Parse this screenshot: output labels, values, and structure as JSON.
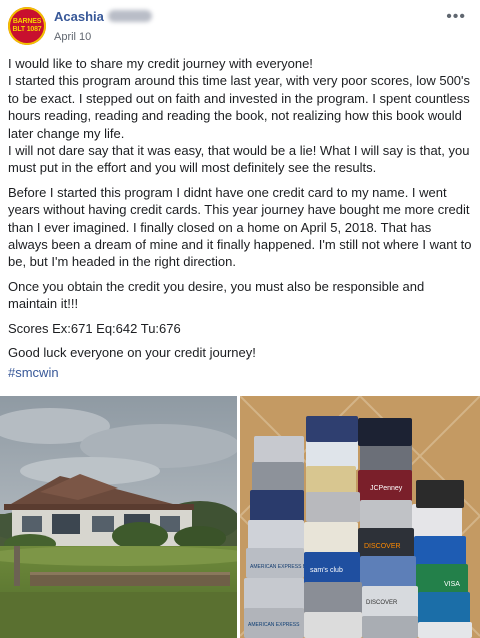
{
  "post": {
    "author": "Acashia",
    "date": "April 10",
    "avatar_text": [
      "BARNES",
      "BLT 1087"
    ],
    "more_icon": "more-dots-icon",
    "paragraphs": [
      "I would like to share my credit journey with everyone!\nI started this program around this time last year, with very poor scores, low 500's to be exact. I stepped out on faith and invested in the program. I spent countless hours reading, reading and reading the book, not realizing how this book would later change my life.\nI will not dare say that it was easy, that would be a lie! What I will say is that, you must put in the effort and you will most definitely see the results.",
      "Before I started this program I didnt have one credit card to my name. I went years without having credit cards. This year journey have bought me more credit than I ever imagined. I finally closed on a home on April 5, 2018. That has always been a dream of mine and it finally happened. I'm still not where I want to be, but I'm headed in the right direction.",
      "Once you obtain the credit you desire, you must also be responsible and maintain it!!!",
      "Scores Ex:671 Eq:642 Tu:676",
      "Good luck everyone on your credit journey!"
    ],
    "hashtag": "#smcwin"
  },
  "photos": {
    "left": {
      "alt": "house photo"
    },
    "right": {
      "alt": "credit cards on floor",
      "card_labels": [
        "JCPenney",
        "DISCOVER",
        "AMERICAN EXPRESS BUSINESS",
        "sam's club",
        "VISA",
        "DISCOVER",
        "AMERICAN EXPRESS"
      ]
    }
  },
  "colors": {
    "link": "#385898",
    "text": "#1c1e21",
    "meta": "#616770"
  }
}
